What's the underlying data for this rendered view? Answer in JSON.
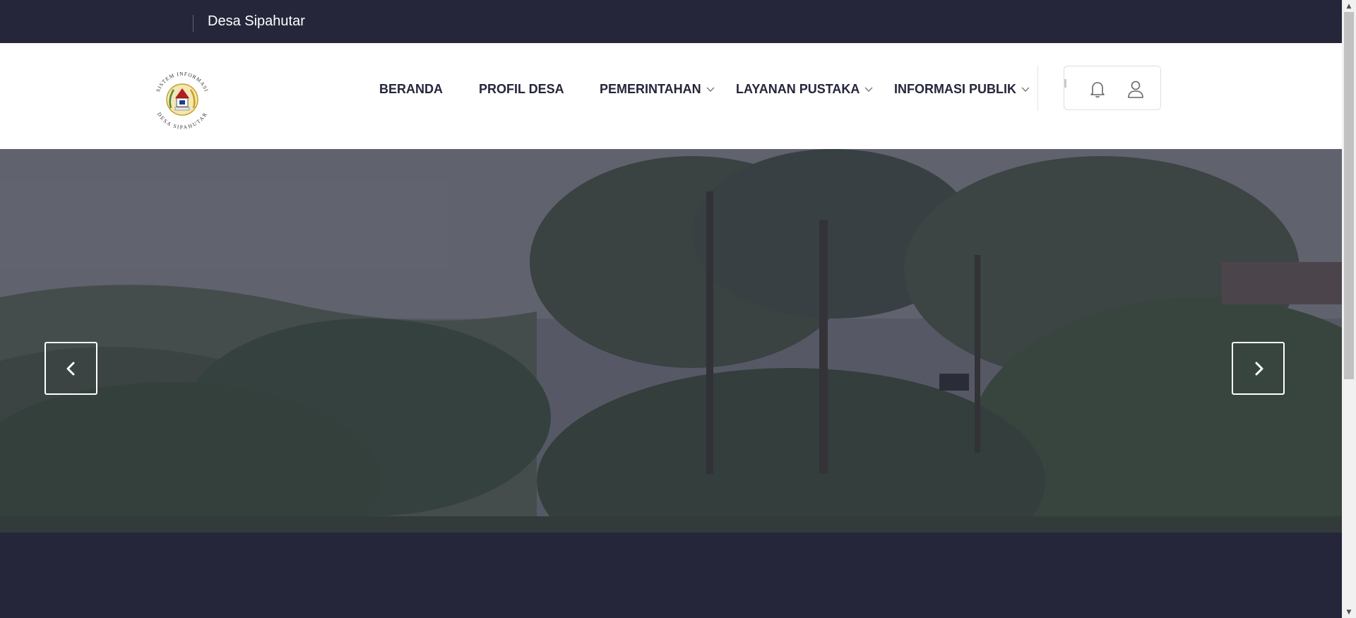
{
  "topbar": {
    "site_name": "Desa Sipahutar"
  },
  "logo": {
    "name": "site-logo",
    "text_top": "SISTEM INFORMASI",
    "text_bottom": "DESA SIPAHUTAR"
  },
  "nav": {
    "items": [
      {
        "label": "BERANDA",
        "has_dropdown": false
      },
      {
        "label": "PROFIL DESA",
        "has_dropdown": false
      },
      {
        "label": "PEMERINTAHAN",
        "has_dropdown": true
      },
      {
        "label": "LAYANAN PUSTAKA",
        "has_dropdown": true
      },
      {
        "label": "INFORMASI PUBLIK",
        "has_dropdown": true
      }
    ]
  },
  "actions": {
    "notification_icon": "bell-icon",
    "account_icon": "user-icon"
  },
  "slider": {
    "prev_icon": "chevron-left-icon",
    "next_icon": "chevron-right-icon"
  },
  "colors": {
    "dark": "#25263a",
    "white": "#ffffff",
    "nav_text": "#25263a"
  }
}
